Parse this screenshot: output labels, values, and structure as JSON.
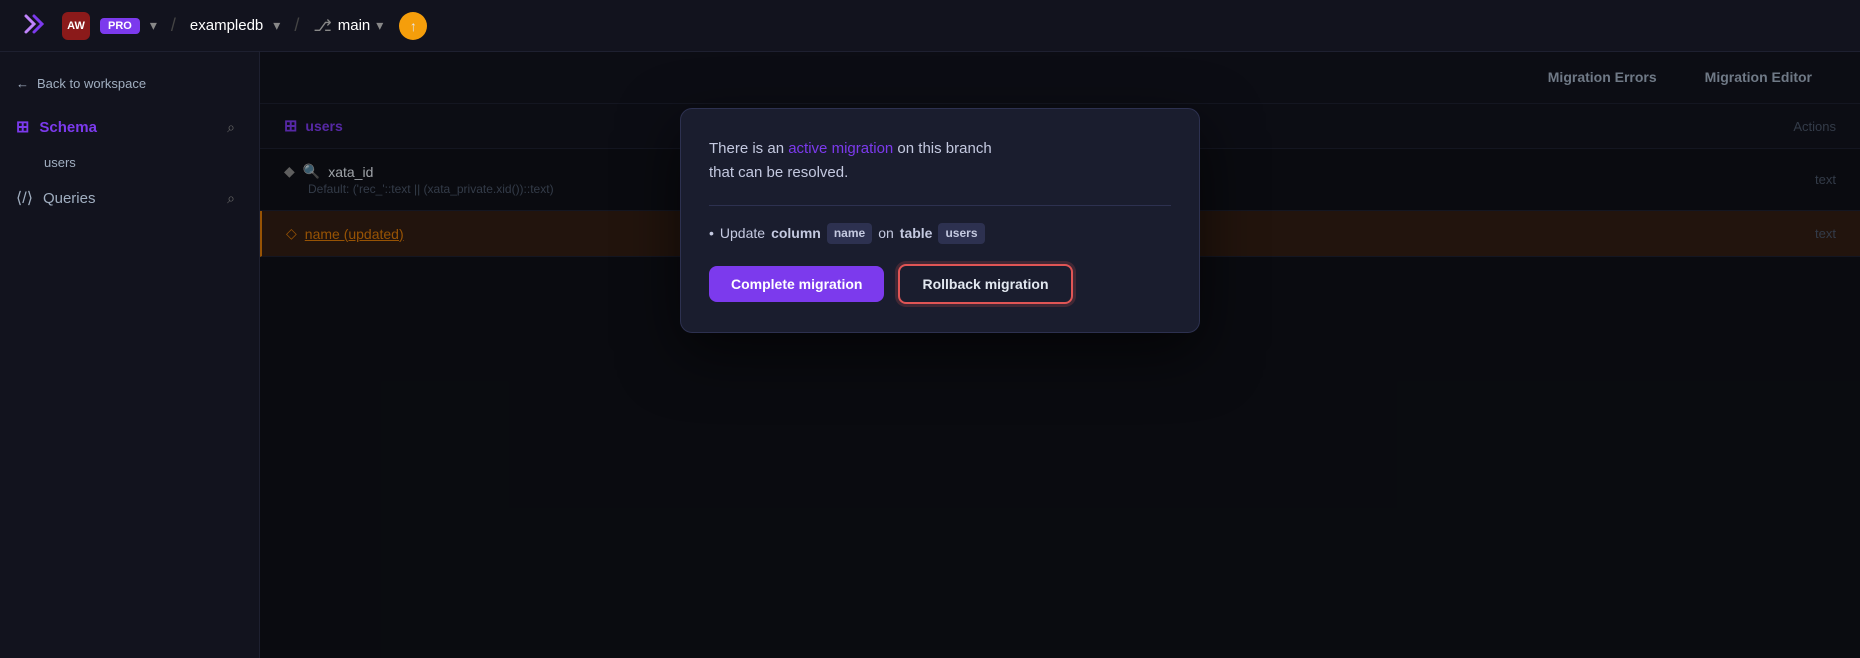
{
  "topNav": {
    "avatarInitials": "AW",
    "proBadge": "PRO",
    "chevron": "▾",
    "separator1": "/",
    "dbName": "exampledb",
    "separator2": "/",
    "branchName": "main",
    "migrationIndicator": "↑"
  },
  "sidebar": {
    "backLabel": "Back to workspace",
    "backArrow": "←",
    "schemaLabel": "Schema",
    "schemaIcon": "⊞",
    "searchIcon": "⌕",
    "tableItem": "users",
    "queriesLabel": "Queries",
    "queriesIcon": "⟨/⟩",
    "queriesSearchIcon": "⌕"
  },
  "contentHeader": {
    "tab1": "Migration Errors",
    "tab2": "Migration Editor"
  },
  "tableSection": {
    "tableName": "users",
    "tableIcon": "⊞",
    "actionsLabel": "Actions",
    "columns": [
      {
        "type": "text",
        "name": "xata_id",
        "default": "Default: ('rec_'::text || (xata_private.xid())::text)",
        "isPrimary": true,
        "isFingerprint": true,
        "updated": false
      },
      {
        "type": "text",
        "name": "name (updated)",
        "default": "",
        "isPrimary": false,
        "isFingerprint": false,
        "updated": true
      }
    ]
  },
  "popup": {
    "text1": "There is an ",
    "activeMigrationLink": "active migration",
    "text2": " on this branch\nthat can be resolved.",
    "bulletPrefix": "•",
    "bulletText1": "Update ",
    "bulletBold1": "column",
    "bulletBadge1": "name",
    "bulletText2": " on ",
    "bulletBold2": "table",
    "bulletBadge2": "users",
    "completeBtnLabel": "Complete migration",
    "rollbackBtnLabel": "Rollback migration"
  },
  "rightPanel": {
    "title": "Migration Editor"
  }
}
